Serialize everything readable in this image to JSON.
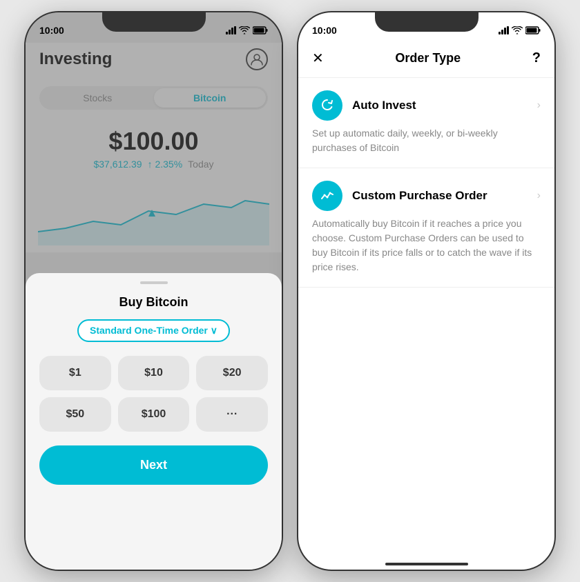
{
  "left_phone": {
    "status_bar": {
      "time": "10:00"
    },
    "header": {
      "title": "Investing"
    },
    "tabs": [
      {
        "label": "Stocks",
        "active": false
      },
      {
        "label": "Bitcoin",
        "active": true
      }
    ],
    "price": {
      "main": "$100.00",
      "btc_price": "$37,612.39",
      "change": "↑ 2.35%",
      "period": "Today"
    },
    "bottom_sheet": {
      "title": "Buy Bitcoin",
      "order_type_label": "Standard One-Time Order ∨",
      "amounts": [
        "$1",
        "$10",
        "$20",
        "$50",
        "$100",
        "···"
      ],
      "next_button": "Next"
    }
  },
  "right_phone": {
    "status_bar": {
      "time": "10:00"
    },
    "header": {
      "close_label": "✕",
      "title": "Order Type",
      "help_label": "?"
    },
    "options": [
      {
        "icon": "↻",
        "name": "Auto Invest",
        "description": "Set up automatic daily, weekly, or bi-weekly purchases of Bitcoin"
      },
      {
        "icon": "≋",
        "name": "Custom Purchase Order",
        "description": "Automatically buy Bitcoin if it reaches a price you choose. Custom Purchase Orders can be used to buy Bitcoin if its price falls or to catch the wave if its price rises."
      }
    ]
  }
}
